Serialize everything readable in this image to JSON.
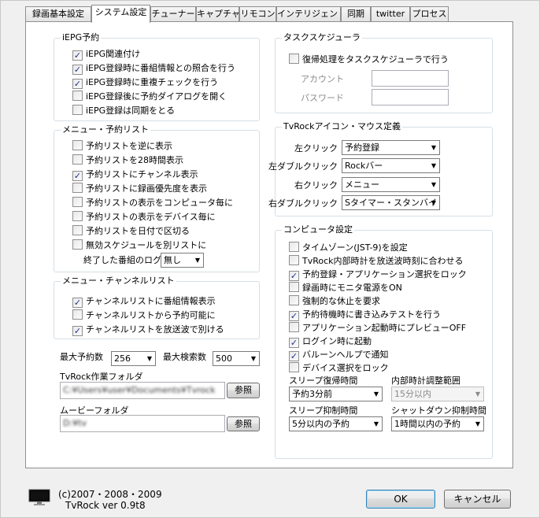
{
  "tabs": [
    "録画基本設定",
    "システム設定",
    "チューナー",
    "キャプチャ",
    "リモコン",
    "インテリジェント",
    "同期",
    "twitter",
    "プロセス"
  ],
  "active_tab": 1,
  "epg": {
    "title": "iEPG予約",
    "items": [
      {
        "label": "iEPG関連付け",
        "checked": true
      },
      {
        "label": "iEPG登録時に番組情報との照合を行う",
        "checked": true
      },
      {
        "label": "iEPG登録時に重複チェックを行う",
        "checked": true
      },
      {
        "label": "iEPG登録後に予約ダイアログを開く",
        "checked": false
      },
      {
        "label": "iEPG登録は同期をとる",
        "checked": false
      }
    ]
  },
  "reservation_list": {
    "title": "メニュー・予約リスト",
    "items": [
      {
        "label": "予約リストを逆に表示",
        "checked": false
      },
      {
        "label": "予約リストを28時間表示",
        "checked": false
      },
      {
        "label": "予約リストにチャンネル表示",
        "checked": true
      },
      {
        "label": "予約リストに録画優先度を表示",
        "checked": false
      },
      {
        "label": "予約リストの表示をコンピュータ毎に",
        "checked": false
      },
      {
        "label": "予約リストの表示をデバイス毎に",
        "checked": false
      },
      {
        "label": "予約リストを日付で区切る",
        "checked": false
      },
      {
        "label": "無効スケジュールを別リストに",
        "checked": false
      }
    ],
    "ended_log_label": "終了した番組のログ",
    "ended_log_value": "無し"
  },
  "channel_list": {
    "title": "メニュー・チャンネルリスト",
    "items": [
      {
        "label": "チャンネルリストに番組情報表示",
        "checked": true
      },
      {
        "label": "チャンネルリストから予約可能に",
        "checked": false
      },
      {
        "label": "チャンネルリストを放送波で別ける",
        "checked": true
      }
    ]
  },
  "max_reservations": {
    "label": "最大予約数",
    "value": "256"
  },
  "max_search": {
    "label": "最大検索数",
    "value": "500"
  },
  "work_folder": {
    "label": "TvRock作業フォルダ",
    "value": "C:¥Users¥user¥Documents¥Tvrock",
    "button": "参照"
  },
  "movie_folder": {
    "label": "ムービーフォルダ",
    "value": "D:¥tv",
    "button": "参照"
  },
  "task_scheduler": {
    "title": "タスクスケジューラ",
    "checkbox": {
      "label": "復帰処理をタスクスケジューラで行う",
      "checked": false
    },
    "account_label": "アカウント",
    "password_label": "パスワード",
    "account_value": "",
    "password_value": ""
  },
  "icon_mouse": {
    "title": "TvRockアイコン・マウス定義",
    "rows": [
      {
        "label": "左クリック",
        "value": "予約登録"
      },
      {
        "label": "左ダブルクリック",
        "value": "Rockバー"
      },
      {
        "label": "右クリック",
        "value": "メニュー"
      },
      {
        "label": "右ダブルクリック",
        "value": "Sタイマー・スタンバイ"
      }
    ]
  },
  "computer": {
    "title": "コンピュータ設定",
    "items": [
      {
        "label": "タイムゾーン(JST-9)を設定",
        "checked": false
      },
      {
        "label": "TvRock内部時計を放送波時刻に合わせる",
        "checked": false
      },
      {
        "label": "予約登録・アプリケーション選択をロック",
        "checked": true
      },
      {
        "label": "録画時にモニタ電源をON",
        "checked": false
      },
      {
        "label": "強制的な休止を要求",
        "checked": false
      },
      {
        "label": "予約待機時に書き込みテストを行う",
        "checked": true
      },
      {
        "label": "アプリケーション起動時にプレビューOFF",
        "checked": false
      },
      {
        "label": "ログイン時に起動",
        "checked": true
      },
      {
        "label": "バルーンヘルプで通知",
        "checked": true
      },
      {
        "label": "デバイス選択をロック",
        "checked": false
      }
    ],
    "sleep_resume_label": "スリープ復帰時間",
    "sleep_resume_value": "予約3分前",
    "clock_adjust_label": "内部時計調整範囲",
    "clock_adjust_value": "15分以内",
    "sleep_suppress_label": "スリープ抑制時間",
    "sleep_suppress_value": "5分以内の予約",
    "shutdown_suppress_label": "シャットダウン抑制時間",
    "shutdown_suppress_value": "1時間以内の予約"
  },
  "footer": {
    "copyright": "(c)2007・2008・2009",
    "version": "TvRock ver 0.9t8",
    "ok_label": "OK",
    "cancel_label": "キャンセル"
  }
}
